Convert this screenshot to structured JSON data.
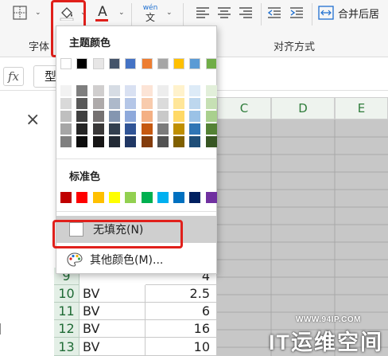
{
  "ribbon": {
    "font_group_label": "字体",
    "align_group_label": "对齐方式",
    "pinyin_top": "wén",
    "pinyin_bottom": "文",
    "font_color_glyph": "A",
    "merge_label": "合并后居"
  },
  "formula_bar": {
    "fx_label": "fx",
    "content": "型"
  },
  "color_menu": {
    "theme_title": "主题颜色",
    "standard_title": "标准色",
    "no_fill_label": "无填充(N)",
    "more_colors_label": "其他颜色(M)...",
    "theme_colors": [
      "#ffffff",
      "#000000",
      "#e7e6e6",
      "#44546a",
      "#4472c4",
      "#ed7d31",
      "#a5a5a5",
      "#ffc000",
      "#5b9bd5",
      "#70ad47"
    ],
    "theme_shades": [
      [
        "#f2f2f2",
        "#d9d9d9",
        "#bfbfbf",
        "#a6a6a6",
        "#7f7f7f"
      ],
      [
        "#7f7f7f",
        "#595959",
        "#404040",
        "#262626",
        "#0d0d0d"
      ],
      [
        "#d0cece",
        "#aeaaaa",
        "#757171",
        "#3a3838",
        "#171616"
      ],
      [
        "#d6dce4",
        "#adb9ca",
        "#8496b0",
        "#323f4f",
        "#222a35"
      ],
      [
        "#d9e1f2",
        "#b4c6e7",
        "#8ea9db",
        "#305496",
        "#203764"
      ],
      [
        "#fce4d6",
        "#f8cbad",
        "#f4b084",
        "#c65911",
        "#833c0c"
      ],
      [
        "#ededed",
        "#dbdbdb",
        "#c9c9c9",
        "#7b7b7b",
        "#525252"
      ],
      [
        "#fff2cc",
        "#ffe699",
        "#ffd966",
        "#bf8f00",
        "#806000"
      ],
      [
        "#ddebf7",
        "#bdd7ee",
        "#9bc2e6",
        "#2f75b5",
        "#1f4e78"
      ],
      [
        "#e2efda",
        "#c6e0b4",
        "#a9d08e",
        "#548235",
        "#375623"
      ]
    ],
    "standard_colors": [
      "#c00000",
      "#ff0000",
      "#ffc000",
      "#ffff00",
      "#92d050",
      "#00b050",
      "#00b0f0",
      "#0070c0",
      "#002060",
      "#7030a0"
    ]
  },
  "sheet": {
    "column_headers": [
      "C",
      "D",
      "E"
    ],
    "rows": [
      {
        "num": "10",
        "type": "BV",
        "value": "2.5"
      },
      {
        "num": "11",
        "type": "BV",
        "value": "6"
      },
      {
        "num": "12",
        "type": "BV",
        "value": "16"
      },
      {
        "num": "13",
        "type": "BV",
        "value": "10"
      }
    ],
    "partial_row_value": "4",
    "partial_row_num": "9"
  },
  "left_pane": {
    "close_glyph": "×"
  },
  "watermark": {
    "url": "WWW.94IP.COM",
    "brand": "IT运维空间"
  }
}
